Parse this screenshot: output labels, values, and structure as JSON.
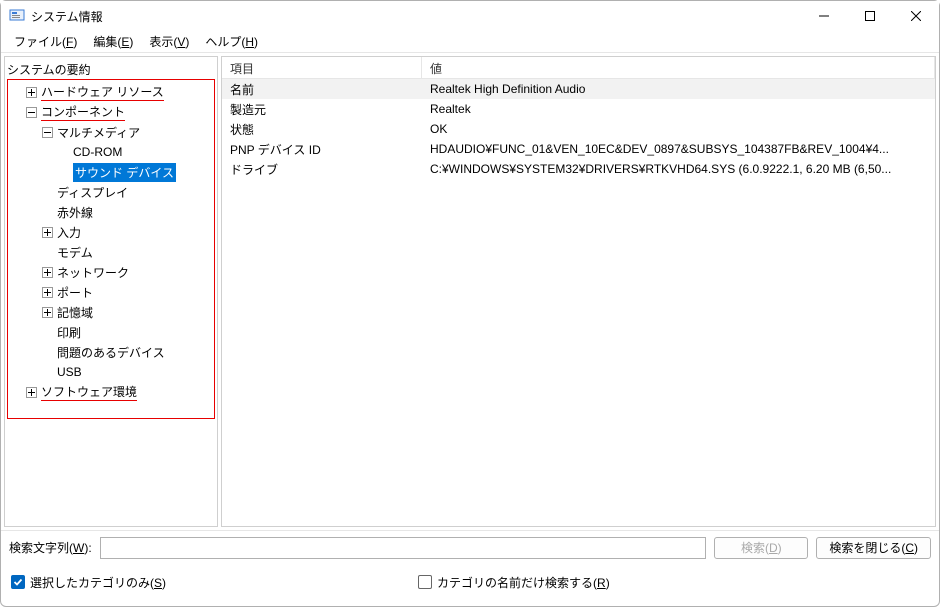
{
  "window": {
    "title": "システム情報"
  },
  "menu": {
    "file": "ファイル(",
    "file_u": "F",
    "file2": ")",
    "edit": "編集(",
    "edit_u": "E",
    "edit2": ")",
    "view": "表示(",
    "view_u": "V",
    "view2": ")",
    "help": "ヘルプ(",
    "help_u": "H",
    "help2": ")"
  },
  "tree": {
    "root": "システムの要約",
    "hardware": "ハードウェア リソース",
    "components": "コンポーネント",
    "multimedia": "マルチメディア",
    "cdrom": "CD-ROM",
    "sound": "サウンド デバイス",
    "display": "ディスプレイ",
    "infrared": "赤外線",
    "input": "入力",
    "modem": "モデム",
    "network": "ネットワーク",
    "port": "ポート",
    "storage": "記憶域",
    "print": "印刷",
    "problem": "問題のあるデバイス",
    "usb": "USB",
    "software": "ソフトウェア環境"
  },
  "columns": {
    "item": "項目",
    "value": "値"
  },
  "rows": [
    {
      "item": "名前",
      "value": "Realtek High Definition Audio"
    },
    {
      "item": "製造元",
      "value": "Realtek"
    },
    {
      "item": "状態",
      "value": "OK"
    },
    {
      "item": "PNP デバイス ID",
      "value": "HDAUDIO¥FUNC_01&VEN_10EC&DEV_0897&SUBSYS_104387FB&REV_1004¥4..."
    },
    {
      "item": "ドライブ",
      "value": "C:¥WINDOWS¥SYSTEM32¥DRIVERS¥RTKVHD64.SYS (6.0.9222.1, 6.20 MB (6,50..."
    }
  ],
  "search": {
    "label": "検索文字列(",
    "label_u": "W",
    "label2": "):",
    "find": "検索(",
    "find_u": "D",
    "find2": ")",
    "close": "検索を閉じる(",
    "close_u": "C",
    "close2": ")"
  },
  "options": {
    "opt1": "選択したカテゴリのみ(",
    "opt1_u": "S",
    "opt1_2": ")",
    "opt2": "カテゴリの名前だけ検索する(",
    "opt2_u": "R",
    "opt2_2": ")"
  }
}
